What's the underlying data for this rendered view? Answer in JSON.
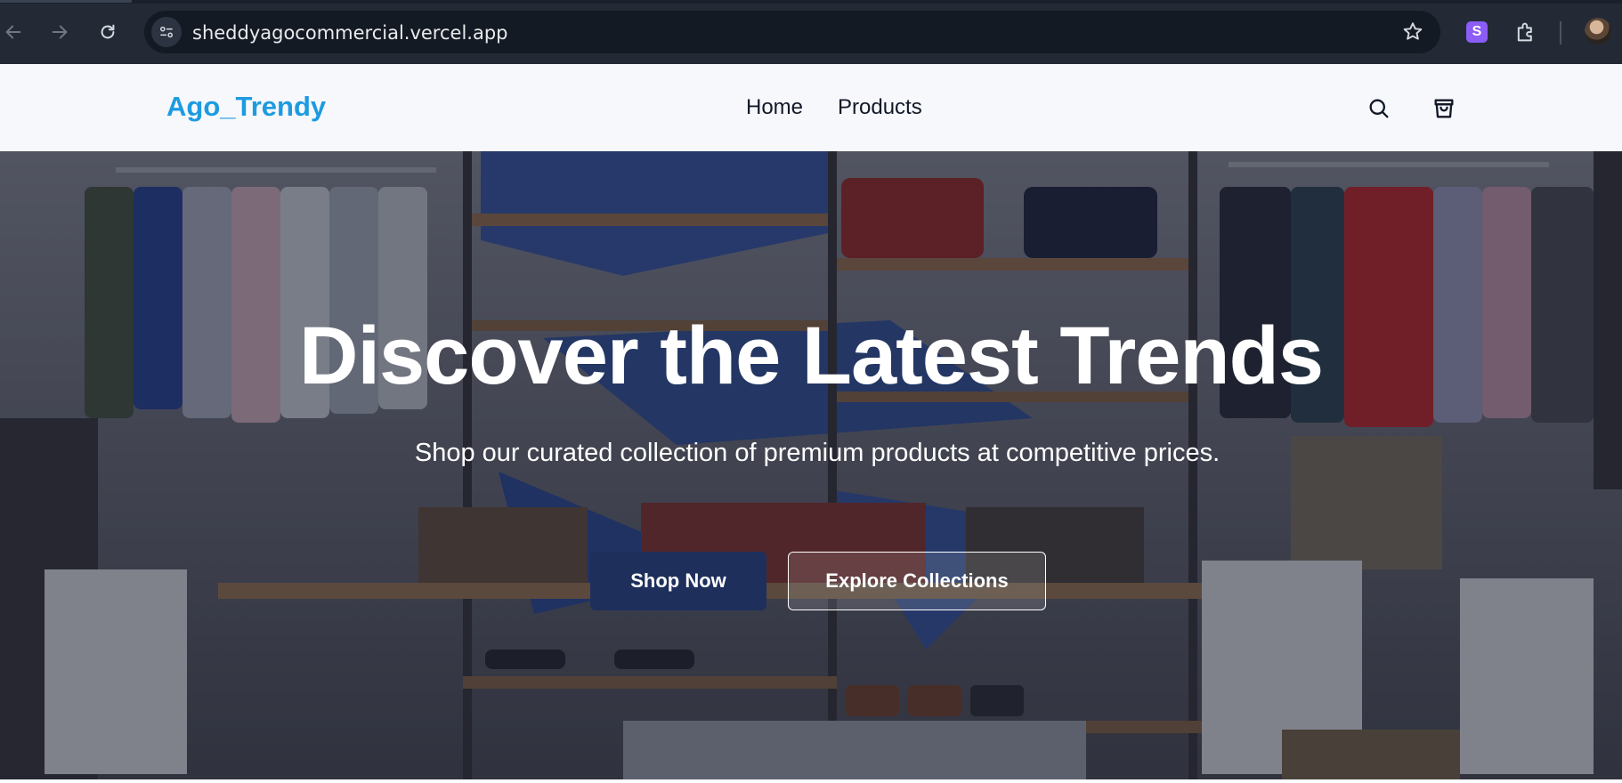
{
  "browser": {
    "url": "sheddyagocommercial.vercel.app",
    "extension_label": "S",
    "icons": {
      "back": "back-arrow-icon",
      "forward": "forward-arrow-icon",
      "reload": "reload-icon",
      "site_info": "tune-icon",
      "bookmark": "star-icon",
      "extensions": "puzzle-icon",
      "profile": "avatar"
    },
    "colors": {
      "chrome": "#232a36",
      "omnibox": "#141a23",
      "extension": "#8b5cf6"
    }
  },
  "header": {
    "logo": "Ago_Trendy",
    "nav": [
      {
        "label": "Home"
      },
      {
        "label": "Products"
      }
    ],
    "icons": {
      "search": "search-icon",
      "cart": "shopping-bag-icon"
    },
    "colors": {
      "logo": "#1d9be0",
      "background": "#f7f8fb"
    }
  },
  "hero": {
    "title": "Discover the Latest Trends",
    "subtitle": "Shop our curated collection of premium products at competitive prices.",
    "primary_button": "Shop Now",
    "secondary_button": "Explore Collections",
    "colors": {
      "primary_button": "#1e2f5c"
    }
  }
}
